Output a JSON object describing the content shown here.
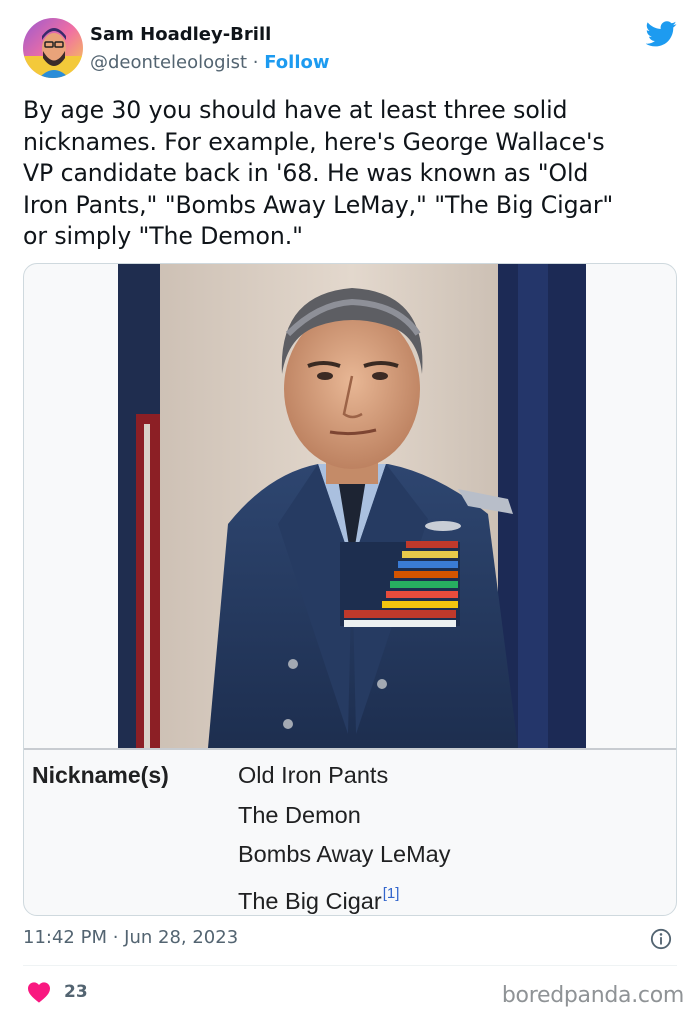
{
  "author": {
    "display_name": "Sam Hoadley-Brill",
    "handle": "@deonteleologist",
    "separator": "·",
    "follow_label": "Follow",
    "avatar_icon": "avatar-illustration"
  },
  "platform_icon": "twitter-bird-icon",
  "tweet": {
    "text": "By age 30 you should have at least three solid\nnicknames. For example, here's George Wallace's\nVP candidate back in '68. He was known as \"Old\nIron Pants,\" \"Bombs Away LeMay,\" \"The Big Cigar\"\nor simply \"The Demon.\""
  },
  "infobox": {
    "label": "Nickname(s)",
    "nicknames": [
      "Old Iron Pants",
      "The Demon",
      "Bombs Away LeMay",
      "The Big Cigar"
    ],
    "ref": "[1]"
  },
  "meta": {
    "timestamp": "11:42 PM · Jun 28, 2023",
    "likes": "23"
  },
  "watermark": "boredpanda.com",
  "colors": {
    "accent": "#1d9bf0",
    "like": "#f91880",
    "link": "#3366cc",
    "muted": "#536471"
  }
}
